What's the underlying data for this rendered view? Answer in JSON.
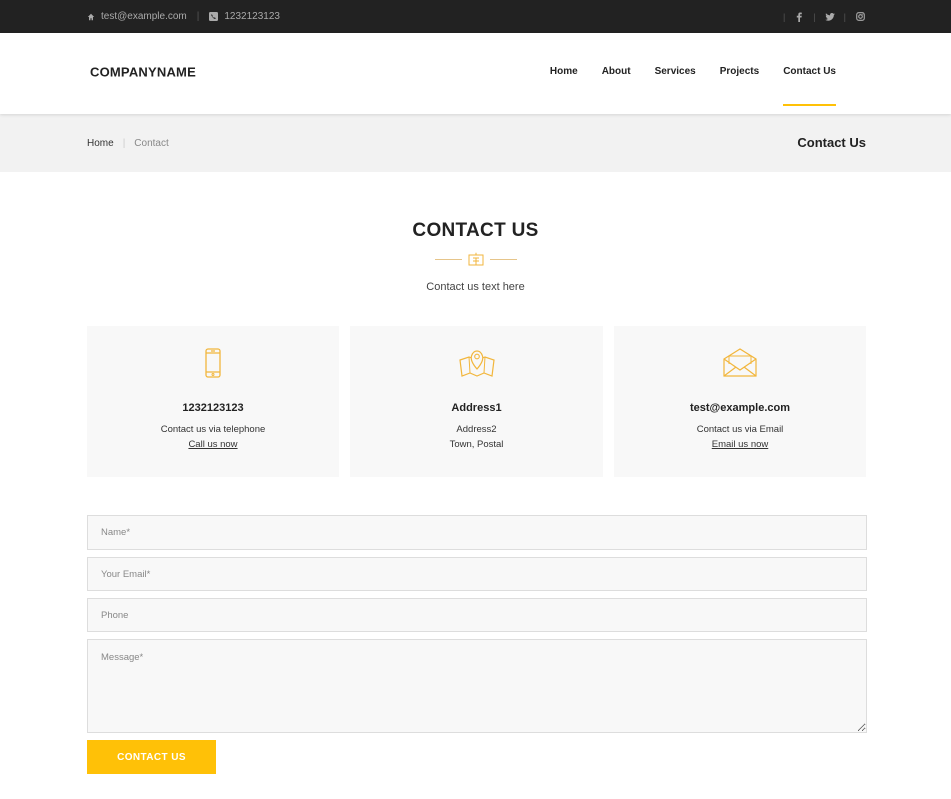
{
  "topbar": {
    "email": "test@example.com",
    "phone": "1232123123",
    "social_icons": [
      "facebook-icon",
      "twitter-icon",
      "instagram-icon"
    ]
  },
  "header": {
    "logo": "COMPANYNAME",
    "nav": [
      {
        "label": "Home"
      },
      {
        "label": "About"
      },
      {
        "label": "Services"
      },
      {
        "label": "Projects"
      },
      {
        "label": "Contact Us",
        "active": true
      }
    ]
  },
  "breadcrumb": {
    "home": "Home",
    "current": "Contact",
    "page_title": "Contact Us"
  },
  "section": {
    "title": "CONTACT US",
    "subtitle": "Contact us text here"
  },
  "cards": [
    {
      "icon": "smartphone-icon",
      "title": "1232123123",
      "line1": "Contact us via telephone",
      "link": "Call us now"
    },
    {
      "icon": "map-pin-icon",
      "title": "Address1",
      "line1": "Address2",
      "line2": "Town, Postal"
    },
    {
      "icon": "envelope-icon",
      "title": "test@example.com",
      "line1": "Contact us via Email",
      "link": "Email us now"
    }
  ],
  "form": {
    "name_placeholder": "Name*",
    "email_placeholder": "Your Email*",
    "phone_placeholder": "Phone",
    "message_placeholder": "Message*",
    "submit_label": "CONTACT US"
  },
  "colors": {
    "accent": "#ffc107",
    "topbar_bg": "#222222",
    "crumb_bg": "#f2f2f2",
    "card_bg": "#f8f8f8"
  }
}
